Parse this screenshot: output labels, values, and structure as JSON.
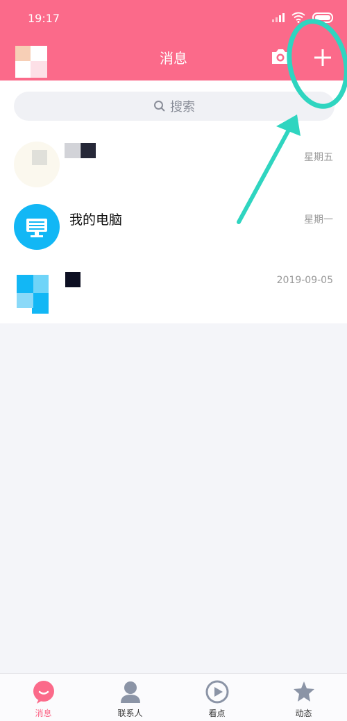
{
  "status_bar": {
    "time": "19:17"
  },
  "header": {
    "title": "消息"
  },
  "search": {
    "placeholder": "搜索"
  },
  "conversations": [
    {
      "name": "",
      "time": "星期五"
    },
    {
      "name": "我的电脑",
      "time": "星期一"
    },
    {
      "name": "",
      "time": "2019-09-05"
    }
  ],
  "tabs": [
    {
      "label": "消息",
      "icon": "chat-bubble-icon"
    },
    {
      "label": "联系人",
      "icon": "person-icon"
    },
    {
      "label": "看点",
      "icon": "play-circle-icon"
    },
    {
      "label": "动态",
      "icon": "star-icon"
    }
  ],
  "colors": {
    "brand": "#fb6a8a",
    "annotation": "#2fd5c0",
    "accent_blue": "#12b7f5"
  }
}
